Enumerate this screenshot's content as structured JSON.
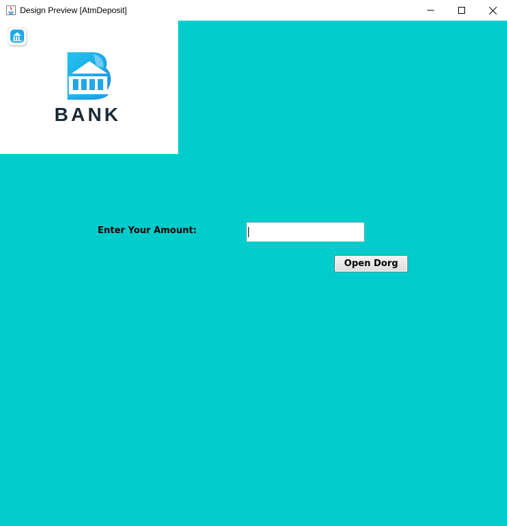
{
  "window": {
    "title": "Design Preview [AtmDeposit]",
    "minimize_icon": "minimize-icon",
    "maximize_icon": "maximize-icon",
    "close_icon": "close-icon"
  },
  "logo": {
    "text": "BANK",
    "icon": "bank-building-icon"
  },
  "form": {
    "amount_label": "Enter Your Amount:",
    "amount_value": "",
    "submit_label": "Open Dorg"
  },
  "colors": {
    "background": "#00cccc",
    "logo_panel": "#ffffff",
    "logo_blue": "#1fa8e8",
    "logo_text": "#1a2a36"
  }
}
